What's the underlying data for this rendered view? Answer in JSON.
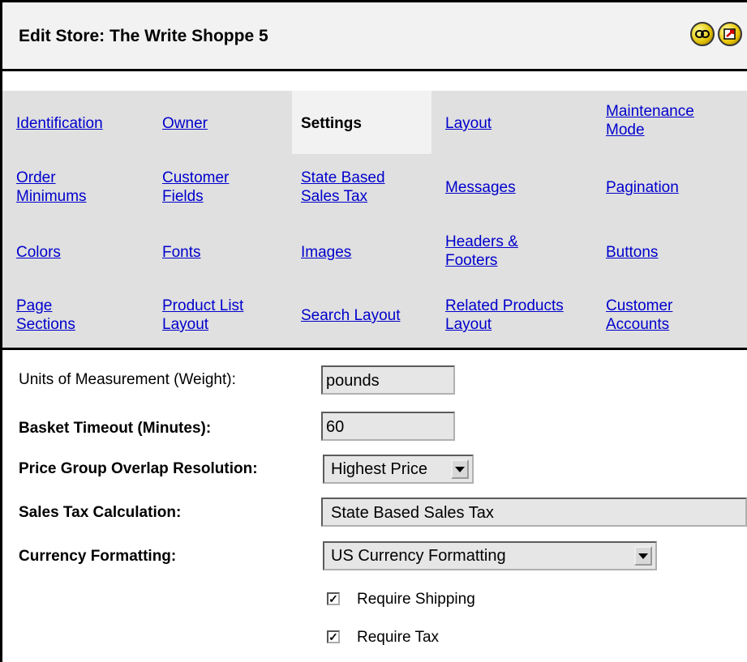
{
  "header": {
    "title": "Edit Store: The Write Shoppe 5",
    "icons": [
      "link-icon",
      "exit-icon"
    ]
  },
  "tabs": [
    {
      "label": "Identification"
    },
    {
      "label": "Owner"
    },
    {
      "label": "Settings",
      "active": true
    },
    {
      "label": "Layout"
    },
    {
      "label": "Maintenance Mode"
    },
    {
      "label": "Order Minimums"
    },
    {
      "label": "Customer Fields"
    },
    {
      "label": "State Based Sales Tax"
    },
    {
      "label": "Messages"
    },
    {
      "label": "Pagination"
    },
    {
      "label": "Colors"
    },
    {
      "label": "Fonts"
    },
    {
      "label": "Images"
    },
    {
      "label": "Headers & Footers"
    },
    {
      "label": "Buttons"
    },
    {
      "label": "Page Sections"
    },
    {
      "label": "Product List Layout"
    },
    {
      "label": "Search Layout"
    },
    {
      "label": "Related Products Layout"
    },
    {
      "label": "Customer Accounts"
    }
  ],
  "form": {
    "units_label": "Units of Measurement (Weight):",
    "units_value": "pounds",
    "timeout_label": "Basket Timeout (Minutes):",
    "timeout_value": "60",
    "overlap_label": "Price Group Overlap Resolution:",
    "overlap_value": "Highest Price",
    "salestax_label": "Sales Tax Calculation:",
    "salestax_value": "State Based Sales Tax",
    "currency_label": "Currency Formatting:",
    "currency_value": "US Currency Formatting",
    "require_shipping_label": "Require Shipping",
    "require_shipping_checked": true,
    "require_tax_label": "Require Tax",
    "require_tax_checked": true
  }
}
